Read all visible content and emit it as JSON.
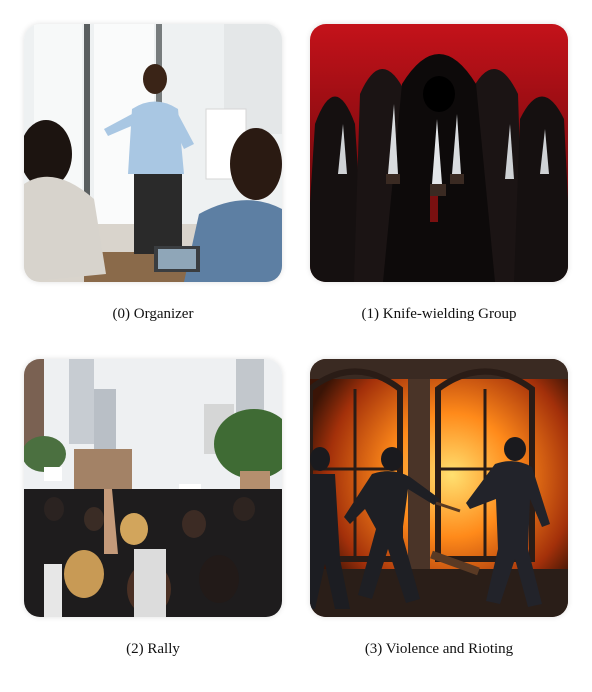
{
  "panels": [
    {
      "index": "(0)",
      "caption": "(0) Organizer"
    },
    {
      "index": "(1)",
      "caption": "(1) Knife-wielding Group"
    },
    {
      "index": "(2)",
      "caption": "(2) Rally"
    },
    {
      "index": "(3)",
      "caption": "(3) Violence and Rioting"
    }
  ]
}
